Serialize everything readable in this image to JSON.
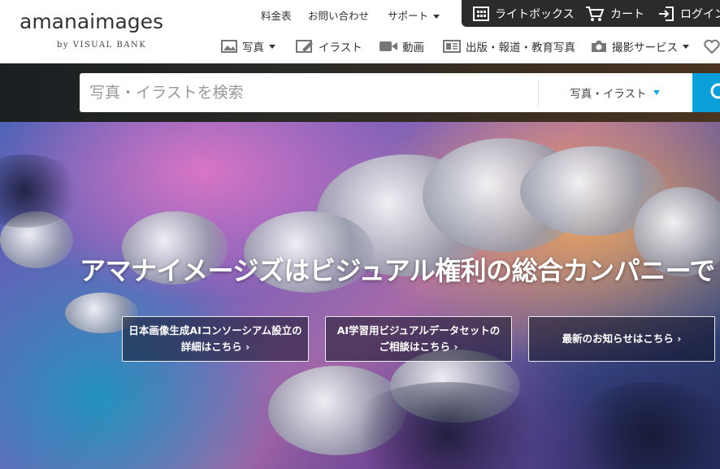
{
  "logo": {
    "main": "amanaimages",
    "sub": "by VISUAL BANK"
  },
  "util_links": {
    "price": "料金表",
    "contact": "お問い合わせ",
    "support": "サポート"
  },
  "account_bar": {
    "lightbox": "ライトボックス",
    "cart": "カート",
    "login": "ログイン"
  },
  "nav": {
    "photo": "写真",
    "illust": "イラスト",
    "video": "動画",
    "editorial": "出版・報道・教育写真",
    "shooting": "撮影サービス"
  },
  "search": {
    "placeholder": "写真・イラストを検索",
    "category": "写真・イラスト"
  },
  "hero": {
    "title": "アマナイメージズはビジュアル権利の総合カンパニーで",
    "cta1_line1": "日本画像生成AIコンソーシアム設立の",
    "cta1_line2": "詳細はこちら ›",
    "cta2_line1": "AI学習用ビジュアルデータセットの",
    "cta2_line2": "ご相談はこちら ›",
    "cta3": "最新のお知らせはこちら ›"
  },
  "colors": {
    "accent": "#0a9fd9",
    "dark_bar": "#2b2b2b"
  }
}
